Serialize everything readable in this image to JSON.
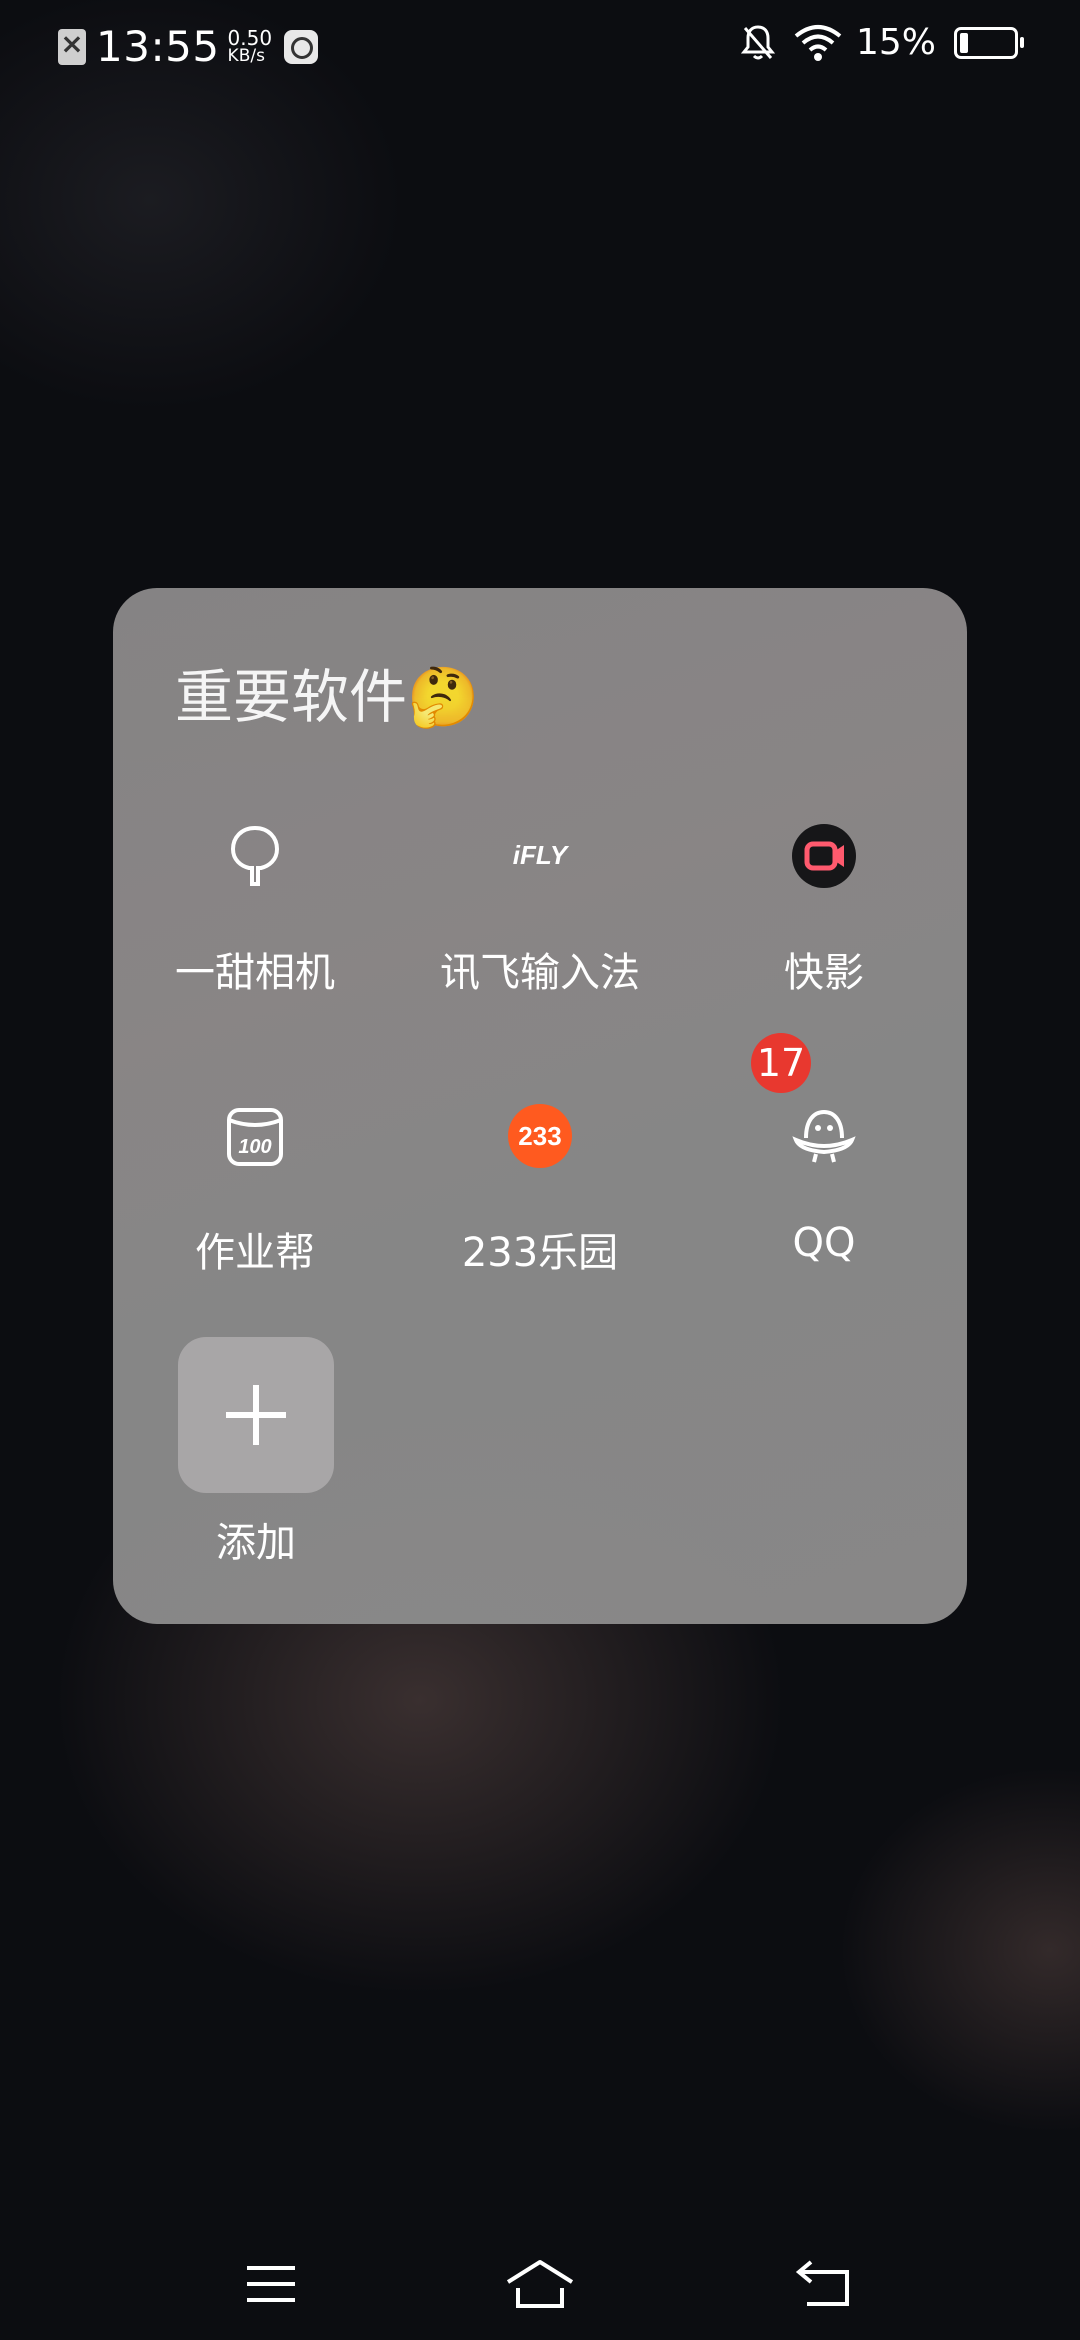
{
  "status_bar": {
    "time": "13:55",
    "net_speed_value": "0.50",
    "net_speed_unit": "KB/s",
    "battery_percent": "15%",
    "battery_level": 0.15,
    "icons": [
      "no-sim-icon",
      "app-notification-icon",
      "silent-bell-icon",
      "wifi-icon",
      "battery-icon"
    ]
  },
  "folder": {
    "title": "重要软件🤔",
    "apps": [
      {
        "label": "一甜相机",
        "icon": "yitian-camera-icon"
      },
      {
        "label": "讯飞输入法",
        "icon": "ifly-icon",
        "icon_text": "iFLY"
      },
      {
        "label": "快影",
        "icon": "kuaiying-icon"
      },
      {
        "label": "作业帮",
        "icon": "zuoyebang-icon",
        "icon_text": "100"
      },
      {
        "label": "233乐园",
        "icon": "233-leyuan-icon",
        "icon_text": "233"
      },
      {
        "label": "QQ",
        "icon": "qq-icon",
        "badge": "17"
      }
    ],
    "add_label": "添加"
  },
  "nav_bar": {
    "buttons": [
      "menu-icon",
      "home-icon",
      "back-icon"
    ]
  },
  "colors": {
    "badge": "#e8382f",
    "folder_bg": "#8b8a8a",
    "kuaiying_accent": "#ff5a6e",
    "leyuan_orange": "#ff5a1f"
  }
}
